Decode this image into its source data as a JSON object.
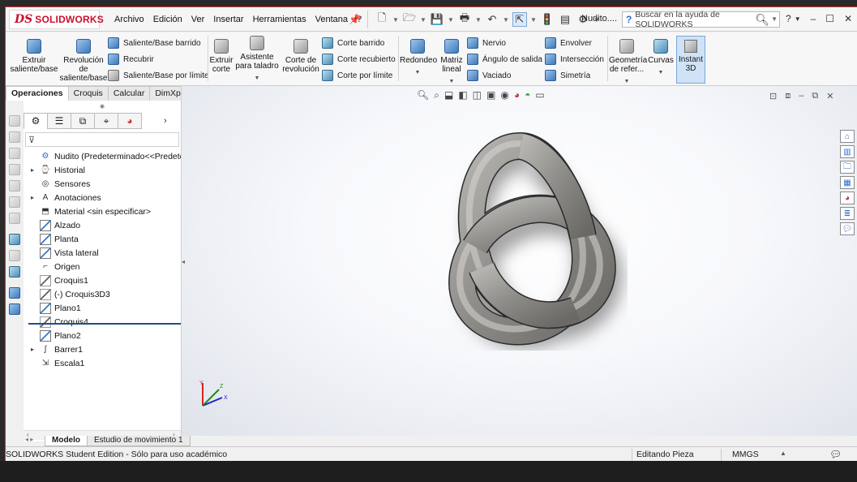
{
  "app": {
    "brand": "SOLIDWORKS",
    "ds": "DS",
    "doc_title": "Nudito....",
    "search_placeholder": "Buscar en la ayuda de SOLIDWORKS"
  },
  "menu": [
    "Archivo",
    "Edición",
    "Ver",
    "Insertar",
    "Herramientas",
    "Ventana",
    "?"
  ],
  "commands": {
    "extruir_saliente": "Extruir saliente/base",
    "revolucion_saliente": "Revolución de saliente/base",
    "saliente_barrido": "Saliente/Base barrido",
    "recubrir": "Recubrir",
    "saliente_limite": "Saliente/Base por límite",
    "extruir_corte": "Extruir corte",
    "asistente_taladro": "Asistente para taladro",
    "corte_revolucion": "Corte de revolución",
    "corte_barrido": "Corte barrido",
    "corte_recubierto": "Corte recubierto",
    "corte_limite": "Corte por límite",
    "redondeo": "Redondeo",
    "matriz_lineal": "Matriz lineal",
    "nervio": "Nervio",
    "angulo_salida": "Ángulo de salida",
    "vaciado": "Vaciado",
    "envolver": "Envolver",
    "interseccion": "Intersección",
    "simetria": "Simetría",
    "geometria_referencia": "Geometría de refer...",
    "curvas": "Curvas",
    "instant3d": "Instant 3D"
  },
  "tabs": [
    "Operaciones",
    "Croquis",
    "Calcular",
    "DimXpert"
  ],
  "tree": {
    "root": "Nudito  (Predeterminado<<Predetern",
    "items": [
      {
        "label": "Historial",
        "expandable": true,
        "icon": "history-icon"
      },
      {
        "label": "Sensores",
        "expandable": false,
        "icon": "sensor-icon"
      },
      {
        "label": "Anotaciones",
        "expandable": true,
        "icon": "annotation-icon"
      },
      {
        "label": "Material <sin especificar>",
        "expandable": false,
        "icon": "material-icon"
      },
      {
        "label": "Alzado",
        "expandable": false,
        "icon": "plane-icon"
      },
      {
        "label": "Planta",
        "expandable": false,
        "icon": "plane-icon"
      },
      {
        "label": "Vista lateral",
        "expandable": false,
        "icon": "plane-icon"
      },
      {
        "label": "Origen",
        "expandable": false,
        "icon": "origin-icon"
      },
      {
        "label": "Croquis1",
        "expandable": false,
        "icon": "sketch-icon"
      },
      {
        "label": "(-) Croquis3D3",
        "expandable": false,
        "icon": "sketch3d-icon"
      },
      {
        "label": "Plano1",
        "expandable": false,
        "icon": "plane-icon"
      },
      {
        "label": "Croquis4",
        "expandable": false,
        "icon": "sketch-icon"
      },
      {
        "label": "Plano2",
        "expandable": false,
        "icon": "plane-icon"
      },
      {
        "label": "Barrer1",
        "expandable": true,
        "icon": "sweep-icon"
      },
      {
        "label": "Escala1",
        "expandable": false,
        "icon": "scale-icon"
      }
    ]
  },
  "bottom_tabs": [
    "Modelo",
    "Estudio de movimiento 1"
  ],
  "status": {
    "edition": "SOLIDWORKS Student Edition - Sólo para uso académico",
    "mode": "Editando Pieza",
    "units": "MMGS"
  },
  "triad": {
    "x": "X",
    "y": "Y",
    "z": "Z"
  }
}
